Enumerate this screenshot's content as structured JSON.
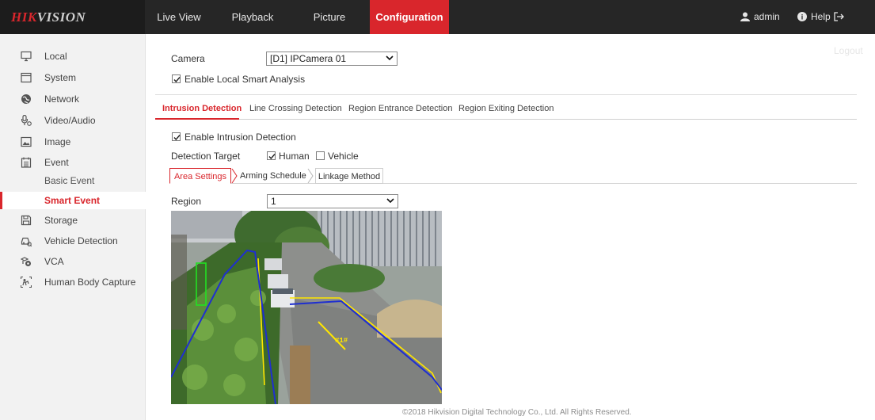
{
  "brand": {
    "logo_red": "HIK",
    "logo_rest": "VISION"
  },
  "nav": {
    "tabs": [
      {
        "label": "Live View"
      },
      {
        "label": "Playback"
      },
      {
        "label": "Picture"
      },
      {
        "label": "Configuration",
        "active": true
      }
    ],
    "user": "admin",
    "help": "Help",
    "logout": "Logout"
  },
  "sidebar": {
    "items": [
      {
        "label": "Local",
        "icon": "monitor-icon"
      },
      {
        "label": "System",
        "icon": "window-icon"
      },
      {
        "label": "Network",
        "icon": "globe-icon"
      },
      {
        "label": "Video/Audio",
        "icon": "microphone-icon"
      },
      {
        "label": "Image",
        "icon": "image-icon"
      },
      {
        "label": "Event",
        "icon": "calendar-icon"
      },
      {
        "label": "Basic Event",
        "sub": true
      },
      {
        "label": "Smart Event",
        "sub": true,
        "active": true
      },
      {
        "label": "Storage",
        "icon": "floppy-icon"
      },
      {
        "label": "Vehicle Detection",
        "icon": "car-icon"
      },
      {
        "label": "VCA",
        "icon": "vca-icon"
      },
      {
        "label": "Human Body Capture",
        "icon": "human-capture-icon"
      }
    ]
  },
  "camera": {
    "label": "Camera",
    "value": "[D1] IPCamera 01"
  },
  "local_smart": {
    "label": "Enable Local Smart Analysis",
    "checked": true
  },
  "detection_tabs": [
    {
      "label": "Intrusion Detection",
      "active": true
    },
    {
      "label": "Line Crossing Detection"
    },
    {
      "label": "Region Entrance Detection"
    },
    {
      "label": "Region Exiting Detection"
    }
  ],
  "enable_intrusion": {
    "label": "Enable Intrusion Detection",
    "checked": true
  },
  "detection_target": {
    "label": "Detection Target",
    "human": {
      "label": "Human",
      "checked": true
    },
    "vehicle": {
      "label": "Vehicle",
      "checked": false
    }
  },
  "settings_tabs": [
    {
      "label": "Area Settings",
      "active": true
    },
    {
      "label": "Arming Schedule"
    },
    {
      "label": "Linkage Method"
    }
  ],
  "region": {
    "label": "Region",
    "value": "1"
  },
  "video": {
    "overlay_text": "#1#"
  },
  "footer": "©2018 Hikvision Digital Technology Co., Ltd. All Rights Reserved.",
  "colors": {
    "accent": "#d9262c",
    "topbar": "#262626",
    "sidebar": "#f2f2f2",
    "region_outline": "#1f2fd0",
    "line_yellow": "#ffe600",
    "target_box": "#22e022"
  }
}
